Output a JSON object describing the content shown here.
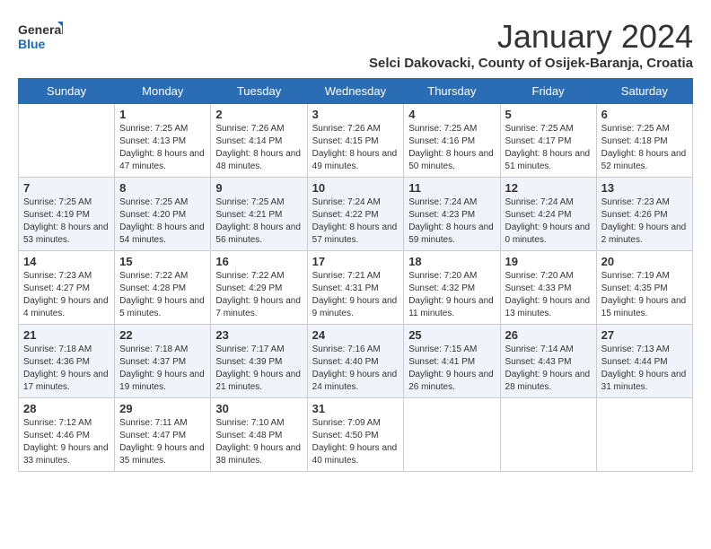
{
  "header": {
    "logo_general": "General",
    "logo_blue": "Blue",
    "month_title": "January 2024",
    "subtitle": "Selci Dakovacki, County of Osijek-Baranja, Croatia"
  },
  "days_of_week": [
    "Sunday",
    "Monday",
    "Tuesday",
    "Wednesday",
    "Thursday",
    "Friday",
    "Saturday"
  ],
  "weeks": [
    [
      {
        "day": "",
        "sunrise": "",
        "sunset": "",
        "daylight": ""
      },
      {
        "day": "1",
        "sunrise": "Sunrise: 7:25 AM",
        "sunset": "Sunset: 4:13 PM",
        "daylight": "Daylight: 8 hours and 47 minutes."
      },
      {
        "day": "2",
        "sunrise": "Sunrise: 7:26 AM",
        "sunset": "Sunset: 4:14 PM",
        "daylight": "Daylight: 8 hours and 48 minutes."
      },
      {
        "day": "3",
        "sunrise": "Sunrise: 7:26 AM",
        "sunset": "Sunset: 4:15 PM",
        "daylight": "Daylight: 8 hours and 49 minutes."
      },
      {
        "day": "4",
        "sunrise": "Sunrise: 7:25 AM",
        "sunset": "Sunset: 4:16 PM",
        "daylight": "Daylight: 8 hours and 50 minutes."
      },
      {
        "day": "5",
        "sunrise": "Sunrise: 7:25 AM",
        "sunset": "Sunset: 4:17 PM",
        "daylight": "Daylight: 8 hours and 51 minutes."
      },
      {
        "day": "6",
        "sunrise": "Sunrise: 7:25 AM",
        "sunset": "Sunset: 4:18 PM",
        "daylight": "Daylight: 8 hours and 52 minutes."
      }
    ],
    [
      {
        "day": "7",
        "sunrise": "Sunrise: 7:25 AM",
        "sunset": "Sunset: 4:19 PM",
        "daylight": "Daylight: 8 hours and 53 minutes."
      },
      {
        "day": "8",
        "sunrise": "Sunrise: 7:25 AM",
        "sunset": "Sunset: 4:20 PM",
        "daylight": "Daylight: 8 hours and 54 minutes."
      },
      {
        "day": "9",
        "sunrise": "Sunrise: 7:25 AM",
        "sunset": "Sunset: 4:21 PM",
        "daylight": "Daylight: 8 hours and 56 minutes."
      },
      {
        "day": "10",
        "sunrise": "Sunrise: 7:24 AM",
        "sunset": "Sunset: 4:22 PM",
        "daylight": "Daylight: 8 hours and 57 minutes."
      },
      {
        "day": "11",
        "sunrise": "Sunrise: 7:24 AM",
        "sunset": "Sunset: 4:23 PM",
        "daylight": "Daylight: 8 hours and 59 minutes."
      },
      {
        "day": "12",
        "sunrise": "Sunrise: 7:24 AM",
        "sunset": "Sunset: 4:24 PM",
        "daylight": "Daylight: 9 hours and 0 minutes."
      },
      {
        "day": "13",
        "sunrise": "Sunrise: 7:23 AM",
        "sunset": "Sunset: 4:26 PM",
        "daylight": "Daylight: 9 hours and 2 minutes."
      }
    ],
    [
      {
        "day": "14",
        "sunrise": "Sunrise: 7:23 AM",
        "sunset": "Sunset: 4:27 PM",
        "daylight": "Daylight: 9 hours and 4 minutes."
      },
      {
        "day": "15",
        "sunrise": "Sunrise: 7:22 AM",
        "sunset": "Sunset: 4:28 PM",
        "daylight": "Daylight: 9 hours and 5 minutes."
      },
      {
        "day": "16",
        "sunrise": "Sunrise: 7:22 AM",
        "sunset": "Sunset: 4:29 PM",
        "daylight": "Daylight: 9 hours and 7 minutes."
      },
      {
        "day": "17",
        "sunrise": "Sunrise: 7:21 AM",
        "sunset": "Sunset: 4:31 PM",
        "daylight": "Daylight: 9 hours and 9 minutes."
      },
      {
        "day": "18",
        "sunrise": "Sunrise: 7:20 AM",
        "sunset": "Sunset: 4:32 PM",
        "daylight": "Daylight: 9 hours and 11 minutes."
      },
      {
        "day": "19",
        "sunrise": "Sunrise: 7:20 AM",
        "sunset": "Sunset: 4:33 PM",
        "daylight": "Daylight: 9 hours and 13 minutes."
      },
      {
        "day": "20",
        "sunrise": "Sunrise: 7:19 AM",
        "sunset": "Sunset: 4:35 PM",
        "daylight": "Daylight: 9 hours and 15 minutes."
      }
    ],
    [
      {
        "day": "21",
        "sunrise": "Sunrise: 7:18 AM",
        "sunset": "Sunset: 4:36 PM",
        "daylight": "Daylight: 9 hours and 17 minutes."
      },
      {
        "day": "22",
        "sunrise": "Sunrise: 7:18 AM",
        "sunset": "Sunset: 4:37 PM",
        "daylight": "Daylight: 9 hours and 19 minutes."
      },
      {
        "day": "23",
        "sunrise": "Sunrise: 7:17 AM",
        "sunset": "Sunset: 4:39 PM",
        "daylight": "Daylight: 9 hours and 21 minutes."
      },
      {
        "day": "24",
        "sunrise": "Sunrise: 7:16 AM",
        "sunset": "Sunset: 4:40 PM",
        "daylight": "Daylight: 9 hours and 24 minutes."
      },
      {
        "day": "25",
        "sunrise": "Sunrise: 7:15 AM",
        "sunset": "Sunset: 4:41 PM",
        "daylight": "Daylight: 9 hours and 26 minutes."
      },
      {
        "day": "26",
        "sunrise": "Sunrise: 7:14 AM",
        "sunset": "Sunset: 4:43 PM",
        "daylight": "Daylight: 9 hours and 28 minutes."
      },
      {
        "day": "27",
        "sunrise": "Sunrise: 7:13 AM",
        "sunset": "Sunset: 4:44 PM",
        "daylight": "Daylight: 9 hours and 31 minutes."
      }
    ],
    [
      {
        "day": "28",
        "sunrise": "Sunrise: 7:12 AM",
        "sunset": "Sunset: 4:46 PM",
        "daylight": "Daylight: 9 hours and 33 minutes."
      },
      {
        "day": "29",
        "sunrise": "Sunrise: 7:11 AM",
        "sunset": "Sunset: 4:47 PM",
        "daylight": "Daylight: 9 hours and 35 minutes."
      },
      {
        "day": "30",
        "sunrise": "Sunrise: 7:10 AM",
        "sunset": "Sunset: 4:48 PM",
        "daylight": "Daylight: 9 hours and 38 minutes."
      },
      {
        "day": "31",
        "sunrise": "Sunrise: 7:09 AM",
        "sunset": "Sunset: 4:50 PM",
        "daylight": "Daylight: 9 hours and 40 minutes."
      },
      {
        "day": "",
        "sunrise": "",
        "sunset": "",
        "daylight": ""
      },
      {
        "day": "",
        "sunrise": "",
        "sunset": "",
        "daylight": ""
      },
      {
        "day": "",
        "sunrise": "",
        "sunset": "",
        "daylight": ""
      }
    ]
  ]
}
